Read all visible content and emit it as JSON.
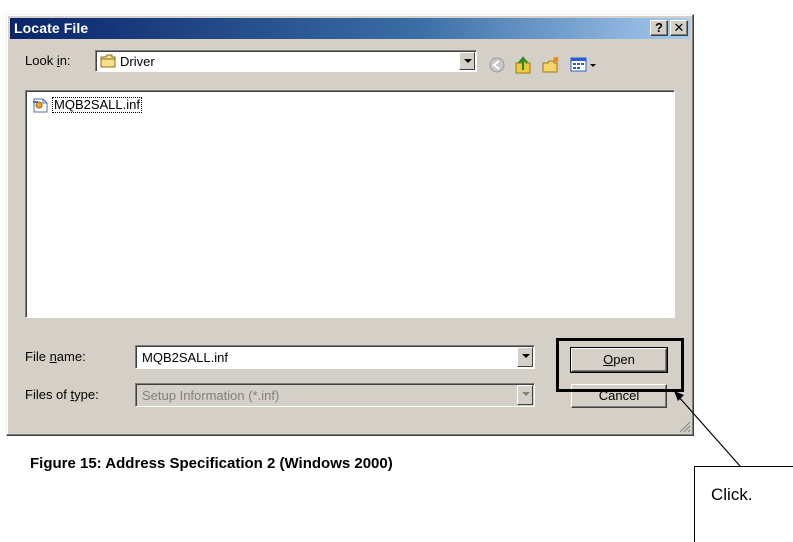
{
  "window": {
    "title": "Locate File",
    "help_button": "?",
    "close_button": "✕"
  },
  "look_in": {
    "label_prefix": "Look ",
    "label_accel": "i",
    "label_suffix": "n:",
    "value": "Driver"
  },
  "toolbar": {
    "icons": [
      "back-icon",
      "up-folder-icon",
      "new-folder-icon",
      "view-menu-icon"
    ]
  },
  "files": [
    {
      "name": "MQB2SALL.inf",
      "icon": "setup-info-file-icon"
    }
  ],
  "filename": {
    "label_prefix": "File ",
    "label_accel": "n",
    "label_suffix": "ame:",
    "value": "MQB2SALL.inf"
  },
  "filetype": {
    "label_prefix": "Files of ",
    "label_accel": "t",
    "label_suffix": "ype:",
    "value": "Setup Information (*.inf)"
  },
  "buttons": {
    "open_accel": "O",
    "open_rest": "pen",
    "cancel": "Cancel"
  },
  "caption": "Figure 15: Address Specification 2 (Windows 2000)",
  "callout": "Click."
}
